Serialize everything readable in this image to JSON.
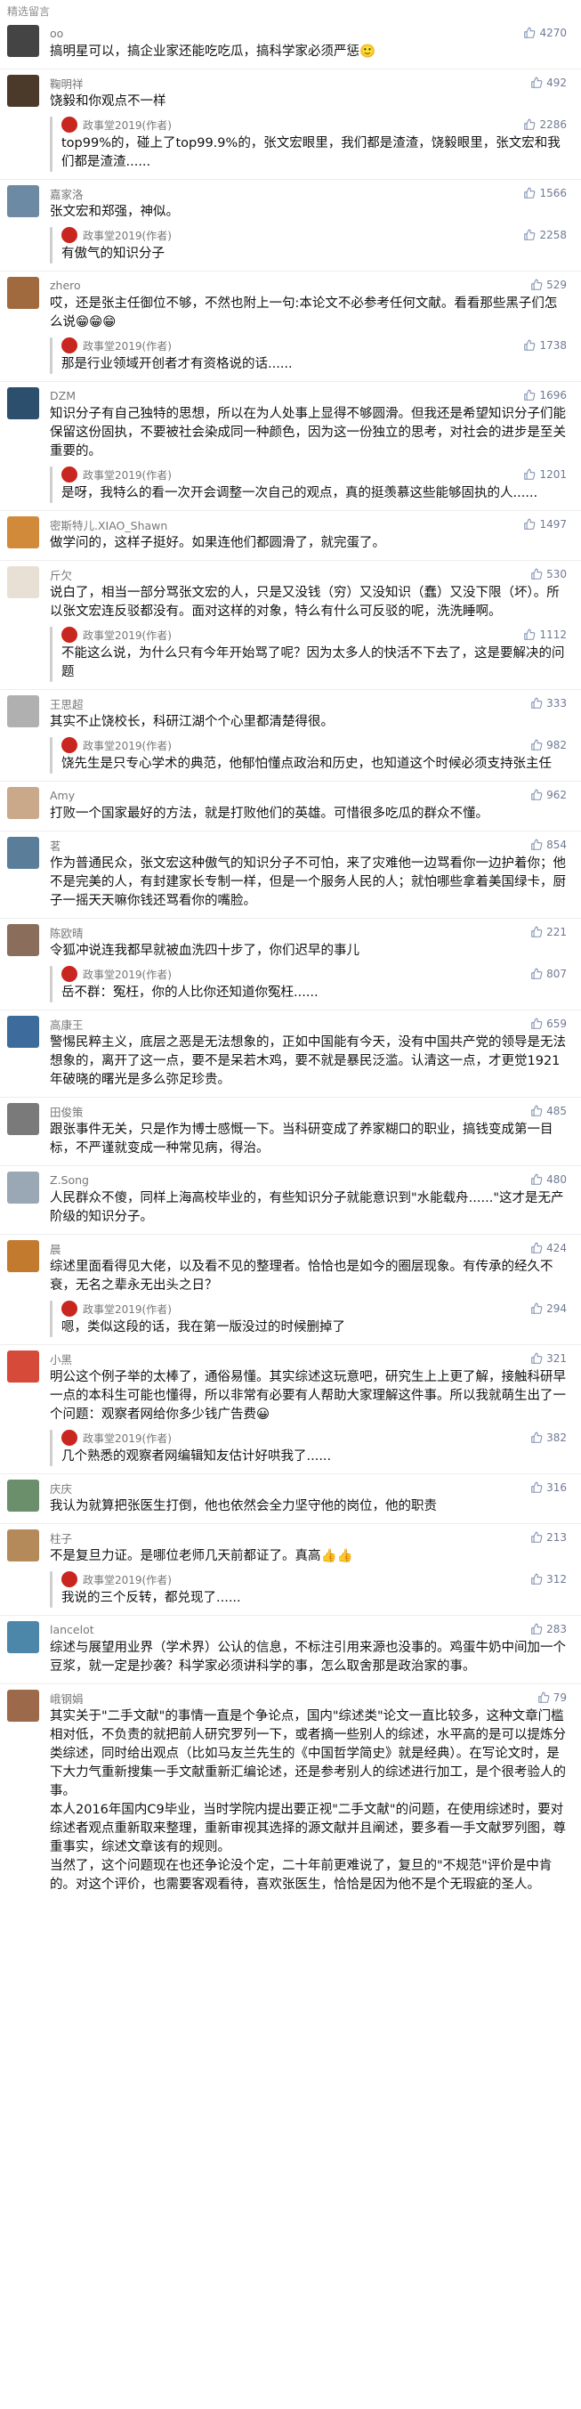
{
  "header": {
    "title": "精选留言"
  },
  "comments": [
    {
      "user": "oo",
      "likes": "4270",
      "text": "搞明星可以，搞企业家还能吃吃瓜，搞科学家必须严惩🙂",
      "reply": null,
      "avatar": "#444444"
    },
    {
      "user": "鞠明祥",
      "likes": "492",
      "text": "饶毅和你观点不一样",
      "reply": {
        "author": "政事堂2019(作者)",
        "likes": "2286",
        "text": "top99%的，碰上了top99.9%的，张文宏眼里，我们都是渣渣，饶毅眼里，张文宏和我们都是渣渣......"
      },
      "avatar": "#4b3a2a"
    },
    {
      "user": "嘉家洛",
      "likes": "1566",
      "text": "张文宏和郑强，神似。",
      "reply": {
        "author": "政事堂2019(作者)",
        "likes": "2258",
        "text": "有傲气的知识分子"
      },
      "avatar": "#6c8aa3"
    },
    {
      "user": "zhero",
      "likes": "529",
      "text": "哎，还是张主任御位不够，不然也附上一句:本论文不必参考任何文献。看看那些黑子们怎么说😁😁😁",
      "reply": {
        "author": "政事堂2019(作者)",
        "likes": "1738",
        "text": "那是行业领域开创者才有资格说的话......"
      },
      "avatar": "#a06a3e"
    },
    {
      "user": "DZM",
      "likes": "1696",
      "text": "知识分子有自己独特的思想，所以在为人处事上显得不够圆滑。但我还是希望知识分子们能保留这份固执，不要被社会染成同一种颜色，因为这一份独立的思考，对社会的进步是至关重要的。",
      "reply": {
        "author": "政事堂2019(作者)",
        "likes": "1201",
        "text": "是呀，我特么的看一次开会调整一次自己的观点，真的挺羡慕这些能够固执的人......"
      },
      "avatar": "#2c4f6e"
    },
    {
      "user": "密斯特儿.XIAO_Shawn",
      "likes": "1497",
      "text": "做学问的，这样子挺好。如果连他们都圆滑了，就完蛋了。",
      "reply": null,
      "avatar": "#d08a3a"
    },
    {
      "user": "斤欠",
      "likes": "530",
      "text": "说白了，相当一部分骂张文宏的人，只是又没钱（穷）又没知识（蠢）又没下限（坏）。所以张文宏连反驳都没有。面对这样的对象，特么有什么可反驳的呢，洗洗睡啊。",
      "reply": {
        "author": "政事堂2019(作者)",
        "likes": "1112",
        "text": "不能这么说，为什么只有今年开始骂了呢？因为太多人的快活不下去了，这是要解决的问题"
      },
      "avatar": "#e8e0d4"
    },
    {
      "user": "王思超",
      "likes": "333",
      "text": "其实不止饶校长，科研江湖个个心里都清楚得很。",
      "reply": {
        "author": "政事堂2019(作者)",
        "likes": "982",
        "text": "饶先生是只专心学术的典范，他郁怕懂点政治和历史，也知道这个时候必须支持张主任"
      },
      "avatar": "#b0b0b0"
    },
    {
      "user": "Amy",
      "likes": "962",
      "text": "打败一个国家最好的方法，就是打败他们的英雄。可惜很多吃瓜的群众不懂。",
      "reply": null,
      "avatar": "#c9a98a"
    },
    {
      "user": "茗",
      "likes": "854",
      "text": "作为普通民众，张文宏这种傲气的知识分子不可怕，来了灾难他一边骂看你一边护着你；他不是完美的人，有封建家长专制一样，但是一个服务人民的人；就怕哪些拿着美国绿卡，厨子一摇天天嘛你钱还骂看你的嘴脸。",
      "reply": null,
      "avatar": "#5a7d9a"
    },
    {
      "user": "陈欧晴",
      "likes": "221",
      "text": "令狐冲说连我都早就被血洗四十步了，你们迟早的事儿",
      "reply": {
        "author": "政事堂2019(作者)",
        "likes": "807",
        "text": "岳不群：冤枉，你的人比你还知道你冤枉......"
      },
      "avatar": "#8a6d5a"
    },
    {
      "user": "高康王",
      "likes": "659",
      "text": "警惕民粹主义，底层之恶是无法想象的，正如中国能有今天，没有中国共产党的领导是无法想象的，离开了这一点，要不是呆若木鸡，要不就是暴民泛滥。认清这一点，才更觉1921年破晓的曙光是多么弥足珍贵。",
      "reply": null,
      "avatar": "#3d6b9c"
    },
    {
      "user": "田俊策",
      "likes": "485",
      "text": "跟张事件无关，只是作为博士感慨一下。当科研变成了养家糊口的职业，搞钱变成第一目标，不严谨就变成一种常见病，得治。",
      "reply": null,
      "avatar": "#7a7a7a"
    },
    {
      "user": "Z.Song",
      "likes": "480",
      "text": "人民群众不傻，同样上海高校毕业的，有些知识分子就能意识到\"水能载舟......\"这才是无产阶级的知识分子。",
      "reply": null,
      "avatar": "#9aa7b5"
    },
    {
      "user": "晨",
      "likes": "424",
      "text": "综述里面看得见大佬，以及看不见的整理者。恰恰也是如今的圈层现象。有传承的经久不衰，无名之辈永无出头之日？",
      "reply": {
        "author": "政事堂2019(作者)",
        "likes": "294",
        "text": "嗯，类似这段的话，我在第一版没过的时候删掉了"
      },
      "avatar": "#c27a2e"
    },
    {
      "user": "小黑",
      "likes": "321",
      "text": "明公这个例子举的太棒了，通俗易懂。其实综述这玩意吧，研究生上上更了解，接触科研早一点的本科生可能也懂得，所以非常有必要有人帮助大家理解这件事。所以我就萌生出了一个问题：观察者网给你多少钱广告费😀",
      "reply": {
        "author": "政事堂2019(作者)",
        "likes": "382",
        "text": "几个熟悉的观察者网编辑知友估计好哄我了......"
      },
      "avatar": "#d64a3a"
    },
    {
      "user": "庆庆",
      "likes": "316",
      "text": "我认为就算把张医生打倒，他也依然会全力坚守他的岗位，他的职责",
      "reply": null,
      "avatar": "#6b8f6b"
    },
    {
      "user": "柱子",
      "likes": "213",
      "text": "不是复旦力证。是哪位老师几天前都证了。真高👍👍",
      "reply": {
        "author": "政事堂2019(作者)",
        "likes": "312",
        "text": "我说的三个反转，都兑现了......"
      },
      "avatar": "#b58a5a"
    },
    {
      "user": "lancelot",
      "likes": "283",
      "text": "综述与展望用业界（学术界）公认的信息，不标注引用来源也没事的。鸡蛋牛奶中间加一个豆浆，就一定是抄袭？科学家必须讲科学的事，怎么取舍那是政治家的事。",
      "reply": null,
      "avatar": "#4c86a8"
    },
    {
      "user": "峨钢娟",
      "likes": "79",
      "text": "其实关于\"二手文献\"的事情一直是个争论点，国内\"综述类\"论文一直比较多，这种文章门槛相对低，不负责的就把前人研究罗列一下，或者摘一些别人的综述，水平高的是可以提炼分类综述，同时给出观点（比如马友兰先生的《中国哲学简史》就是经典）。在写论文时，是下大力气重新搜集一手文献重新汇编论述，还是参考别人的综述进行加工，是个很考验人的事。\n本人2016年国内C9毕业，当时学院内提出要正视\"二手文献\"的问题，在使用综述时，要对综述者观点重新取来整理，重新审视其选择的源文献并且阐述，要多看一手文献罗列图，尊重事实，综述文章该有的规则。\n当然了，这个问题现在也还争论没个定，二十年前更难说了，复旦的\"不规范\"评价是中肯的。对这个评价，也需要客观看待，喜欢张医生，恰恰是因为他不是个无瑕疵的圣人。",
      "reply": null,
      "avatar": "#9c6a4a"
    }
  ]
}
